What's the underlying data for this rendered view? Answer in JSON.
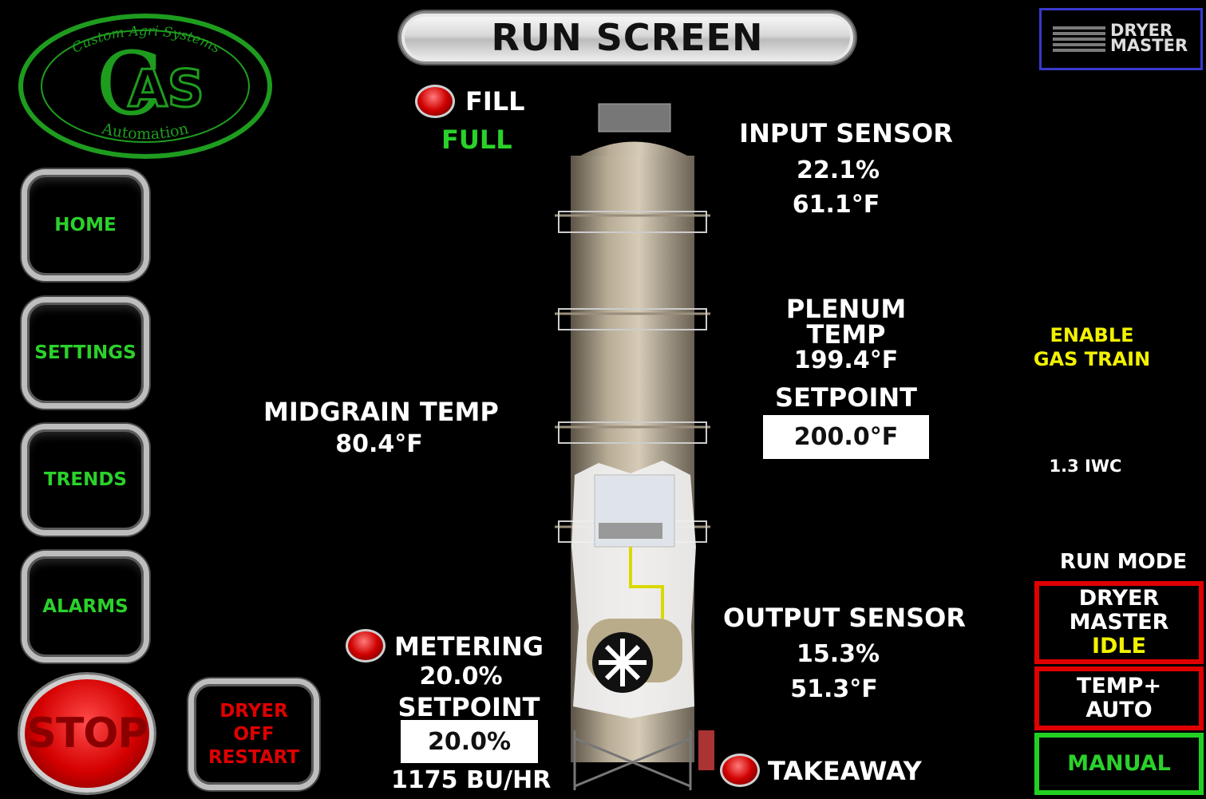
{
  "title": "RUN SCREEN",
  "logo": {
    "arc_top": "Custom Agri Systems",
    "letters": "AS",
    "arc_bottom": "Automation",
    "color": "#1e9c1e"
  },
  "brand": {
    "line1": "DRYER",
    "line2": "MASTER",
    "border_color": "#3a3acd"
  },
  "nav": {
    "home": "HOME",
    "settings": "SETTINGS",
    "trends": "TRENDS",
    "alarms": "ALARMS",
    "stop": "STOP"
  },
  "restart": {
    "line1": "DRYER",
    "line2": "OFF",
    "line3": "RESTART"
  },
  "fill": {
    "label": "FILL",
    "status": "FULL"
  },
  "input_sensor": {
    "label": "INPUT SENSOR",
    "moisture": "22.1%",
    "temp": "61.1°F"
  },
  "plenum": {
    "label1": "PLENUM",
    "label2": "TEMP",
    "value": "199.4°F",
    "setpoint_label": "SETPOINT",
    "setpoint": "200.0°F"
  },
  "gas_train": {
    "line1": "ENABLE",
    "line2": "GAS TRAIN"
  },
  "pressure": "1.3 IWC",
  "midgrain": {
    "label": "MIDGRAIN TEMP",
    "value": "80.4°F"
  },
  "output_sensor": {
    "label": "OUTPUT SENSOR",
    "moisture": "15.3%",
    "temp": "51.3°F"
  },
  "metering": {
    "label": "METERING",
    "value": "20.0%",
    "setpoint_label": "SETPOINT",
    "setpoint": "20.0%",
    "rate": "1175 BU/HR"
  },
  "takeaway": {
    "label": "TAKEAWAY"
  },
  "run_mode": {
    "label": "RUN MODE",
    "dm_line1": "DRYER",
    "dm_line2": "MASTER",
    "dm_status": "IDLE",
    "temp_line1": "TEMP+",
    "temp_line2": "AUTO",
    "manual": "MANUAL"
  },
  "colors": {
    "accent_green": "#2bd12b",
    "alarm_red": "#e00000",
    "status_yellow": "#f2f200",
    "background": "#000000"
  }
}
